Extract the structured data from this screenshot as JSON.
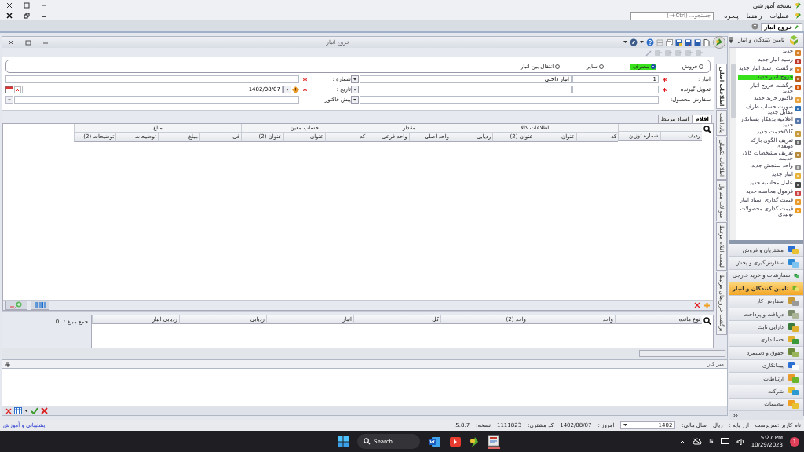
{
  "app_title": "نسخه آموزشی",
  "menu": [
    "عملیات",
    "راهنما",
    "پنجره"
  ],
  "search": {
    "placeholder": "جستجو... (Ctrl+-)"
  },
  "doc_tabs": [
    {
      "label": "خروج انبار",
      "selected": true
    }
  ],
  "form": {
    "title": "خروج انبار",
    "types": [
      {
        "label": "فروش",
        "selected": false
      },
      {
        "label": "مصرف",
        "selected": true
      },
      {
        "label": "سایر",
        "selected": false
      },
      {
        "label": "انتقال بین انبار",
        "selected": false
      }
    ],
    "warehouse": {
      "label": "انبار :",
      "required": true,
      "code": "1",
      "name": "انبار داخلی"
    },
    "number": {
      "label": "شماره :",
      "required": true
    },
    "receiver": {
      "label": "تحویل گیرنده :",
      "required": true
    },
    "date": {
      "label": "تاریخ :",
      "required": true,
      "value": "1402/08/07"
    },
    "product_order": {
      "label": "سفارش محصول:"
    },
    "proforma": {
      "label": "پیش فاکتور"
    },
    "side_tabs": [
      {
        "label": "اطلاعات اصلی",
        "selected": true
      },
      {
        "label": "یادداشت",
        "selected": false
      },
      {
        "label": "اطلاعات تکمیلی",
        "selected": false
      },
      {
        "label": "سوالات متداول",
        "selected": false
      },
      {
        "label": "لیست اقلام مرتبط",
        "selected": false
      },
      {
        "label": "برگشت خروج‌های مرتبط",
        "selected": false
      }
    ],
    "grid_tabs": [
      {
        "label": "اقلام",
        "selected": true
      },
      {
        "label": "اسناد مرتبط",
        "selected": false
      }
    ],
    "column_groups": [
      {
        "columns": [
          "ردیف",
          "شماره توزین"
        ]
      },
      {
        "label": "اطلاعات کالا",
        "columns": [
          "کد",
          "عنوان",
          "عنوان (2)",
          "ردیابی"
        ]
      },
      {
        "label": "مقدار",
        "columns": [
          "واحد اصلی",
          "واحد فرعی"
        ]
      },
      {
        "label": "حساب معین",
        "columns": [
          "کد",
          "عنوان",
          "عنوان (2)"
        ]
      },
      {
        "label": "مبلغ",
        "columns": [
          "فی",
          "مبلغ",
          "توضیحات",
          "توضیحات (2)"
        ]
      }
    ],
    "stock_columns": [
      "نوع مانده",
      "واحد",
      "واحد (2)",
      "کل",
      "انبار",
      "ردیابی",
      "ردیابی انبار"
    ],
    "sum": {
      "label": "جمع مبلغ :",
      "value": "0"
    }
  },
  "workdesk": {
    "title": "میز کار"
  },
  "sidebar": {
    "title": "تامین کنندگان و انبار",
    "items": [
      {
        "label": "جدید",
        "selected": false
      },
      {
        "label": "رسید انبار جدید",
        "selected": false
      },
      {
        "label": "برگشت رسید انبار جدید",
        "selected": false
      },
      {
        "label": "خروج انبار جدید",
        "selected": true
      },
      {
        "label": "برگشت خروج انبار جدید",
        "selected": false
      },
      {
        "label": "فاکتور خرید جدید",
        "selected": false
      },
      {
        "label": "صورت حساب طرف مقابل جدید",
        "selected": false
      },
      {
        "label": "اعلامیه بدهکار بستانکار جدید",
        "selected": false
      },
      {
        "label": "کالا/خدمت جدید",
        "selected": false
      },
      {
        "label": "تعریف الگوی بارکد دوبعدی",
        "selected": false
      },
      {
        "label": "تعریف مشخصات کالا/خدمت",
        "selected": false
      },
      {
        "label": "واحد سنجش جدید",
        "selected": false
      },
      {
        "label": "انبار جدید",
        "selected": false
      },
      {
        "label": "عامل محاسبه جدید",
        "selected": false
      },
      {
        "label": "فرمول محاسبه جدید",
        "selected": false
      },
      {
        "label": "قیمت گذاری اسناد انبار",
        "selected": false
      },
      {
        "label": "قیمت گذاری محصولات تولیدی",
        "selected": false
      }
    ],
    "modules": [
      {
        "label": "مشتریان و فروش",
        "selected": false
      },
      {
        "label": "سفارش‌گیری و پخش",
        "selected": false
      },
      {
        "label": "سفارشات و خرید خارجی",
        "selected": false
      },
      {
        "label": "تامین کنندگان و انبار",
        "selected": true
      },
      {
        "label": "سفارش کار",
        "selected": false
      },
      {
        "label": "دریافت و پرداخت",
        "selected": false
      },
      {
        "label": "دارایی ثابت",
        "selected": false
      },
      {
        "label": "حسابداری",
        "selected": false
      },
      {
        "label": "حقوق و دستمزد",
        "selected": false
      },
      {
        "label": "پیمانکاری",
        "selected": false
      },
      {
        "label": "ارتباطات",
        "selected": false
      },
      {
        "label": "شرکت",
        "selected": false
      },
      {
        "label": "تنظیمات",
        "selected": false
      }
    ]
  },
  "status_bar": {
    "account_items": [
      "نام کاربر :سرپرست",
      "ارز پایه :",
      "ریال",
      "سال مالی:"
    ],
    "year": "1402",
    "info_items": [
      "امروز :",
      "1402/08/07",
      "کد مشتری:",
      "1111823",
      "نسخه:",
      "5.8.7"
    ],
    "support_link": "پشتیبانی و آموزش"
  },
  "taskbar": {
    "search": "Search",
    "language": "فا",
    "time": "5:27 PM",
    "date": "10/29/2023",
    "notifications": "1"
  }
}
